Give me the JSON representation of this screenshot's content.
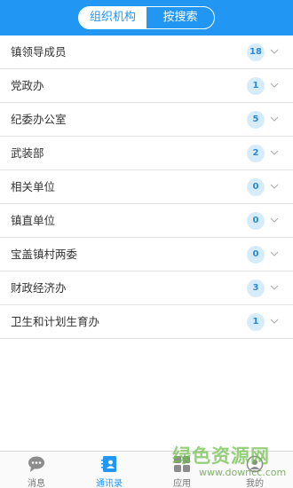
{
  "header": {
    "tabs": [
      {
        "label": "组织机构",
        "active": true
      },
      {
        "label": "按搜索",
        "active": false
      }
    ]
  },
  "departments": [
    {
      "name": "镇领导成员",
      "count": "18"
    },
    {
      "name": "党政办",
      "count": "1"
    },
    {
      "name": "纪委办公室",
      "count": "5"
    },
    {
      "name": "武装部",
      "count": "2"
    },
    {
      "name": "相关单位",
      "count": "0"
    },
    {
      "name": "镇直单位",
      "count": "0"
    },
    {
      "name": "宝盖镇村两委",
      "count": "0"
    },
    {
      "name": "财政经济办",
      "count": "3"
    },
    {
      "name": "卫生和计划生育办",
      "count": "1"
    }
  ],
  "bottom_nav": [
    {
      "label": "消息",
      "icon": "chat-bubble-icon",
      "active": false
    },
    {
      "label": "通讯录",
      "icon": "contacts-icon",
      "active": true
    },
    {
      "label": "应用",
      "icon": "apps-grid-icon",
      "active": false
    },
    {
      "label": "我的",
      "icon": "person-icon",
      "active": false
    }
  ],
  "watermark": {
    "title": "绿色资源网",
    "url": "www.downcc.com"
  },
  "colors": {
    "primary": "#2196f3",
    "badge_bg": "#d7ecfb",
    "badge_text": "#2a8ad6",
    "divider": "#e3e3e3"
  }
}
